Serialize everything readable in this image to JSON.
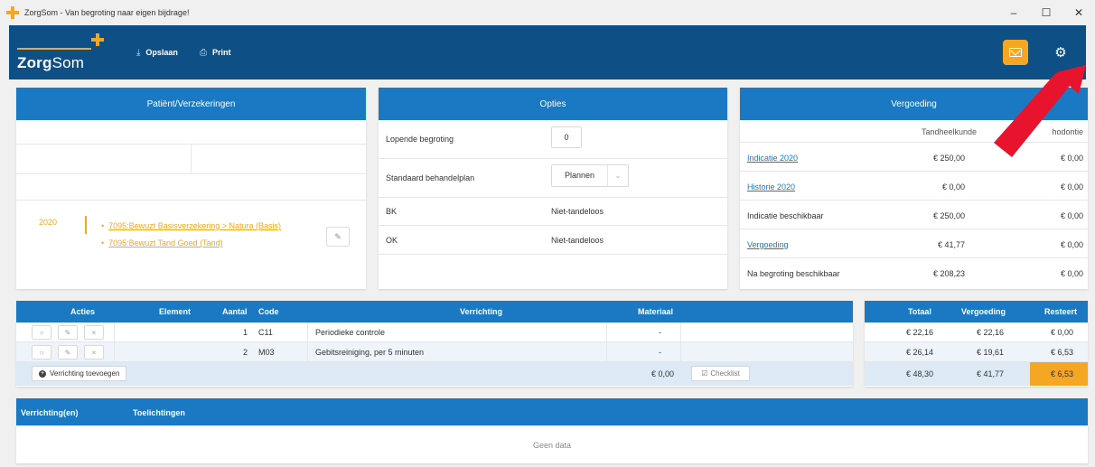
{
  "window": {
    "title": "ZorgSom - Van begroting naar eigen bijdrage!",
    "controls": [
      "–",
      "☐",
      "✕"
    ]
  },
  "header": {
    "logo_bold": "Zorg",
    "logo_light": "Som",
    "save_icon": "⤓",
    "save_label": "Opslaan",
    "print_icon": "⎙",
    "print_label": "Print",
    "gear_icon": "⚙",
    "accent": "#f5a623",
    "bar_color": "#0e4f86"
  },
  "patient": {
    "title": "Patiënt/Verzekeringen",
    "year": "2020",
    "policies": [
      "7095:Bewuzt Basisverzekering > Natura (Basis)",
      "7095:Bewuzt Tand Goed (Tand)"
    ],
    "edit_icon": "✎"
  },
  "options": {
    "title": "Opties",
    "rows": [
      {
        "label": "Lopende begroting",
        "value": "0"
      },
      {
        "label": "Standaard behandelplan",
        "value": "Plannen",
        "chevron": "⌄"
      },
      {
        "label": "BK",
        "value": "Niet-tandeloos"
      },
      {
        "label": "OK",
        "value": "Niet-tandeloos"
      }
    ]
  },
  "reimbursement": {
    "title": "Vergoeding",
    "columns": [
      "Tandheelkunde",
      "hodontie"
    ],
    "rows": [
      {
        "label": "Indicatie 2020",
        "a": "€ 250,00",
        "b": "€ 0,00",
        "link": true
      },
      {
        "label": "Historie 2020",
        "a": "€ 0,00",
        "b": "€ 0,00",
        "link": true
      },
      {
        "label": "Indicatie beschikbaar",
        "a": "€ 250,00",
        "b": "€ 0,00",
        "link": false
      },
      {
        "label": "Vergoeding",
        "a": "€ 41,77",
        "b": "€ 0,00",
        "link": true
      },
      {
        "label": "Na begroting beschikbaar",
        "a": "€ 208,23",
        "b": "€ 0,00",
        "link": false
      }
    ]
  },
  "treatments": {
    "headers": [
      "Acties",
      "Element",
      "Aantal",
      "Code",
      "Verrichting",
      "Materiaal"
    ],
    "action_icons": [
      "○",
      "✎",
      "×"
    ],
    "rows": [
      {
        "aantal": "1",
        "code": "C11",
        "verrichting": "Periodieke controle",
        "materiaal": "-"
      },
      {
        "aantal": "2",
        "code": "M03",
        "verrichting": "Gebitsreiniging, per 5 minuten",
        "materiaal": "-"
      }
    ],
    "add_label": "Verrichting toevoegen",
    "add_icon": "+",
    "material_total": "€ 0,00",
    "checklist_icon": "☑",
    "checklist_label": "Checklist"
  },
  "totals": {
    "headers": [
      "Totaal",
      "Vergoeding",
      "Resteert"
    ],
    "rows": [
      [
        "€ 22,16",
        "€ 22,16",
        "€ 0,00"
      ],
      [
        "€ 26,14",
        "€ 19,61",
        "€ 6,53"
      ]
    ],
    "footer": [
      "€ 48,30",
      "€ 41,77",
      "€ 6,53"
    ]
  },
  "notes": {
    "headers": [
      "Verrichting(en)",
      "Toelichtingen"
    ],
    "empty": "Geen data"
  },
  "annotation": {
    "arrow_color": "#e8142d"
  }
}
